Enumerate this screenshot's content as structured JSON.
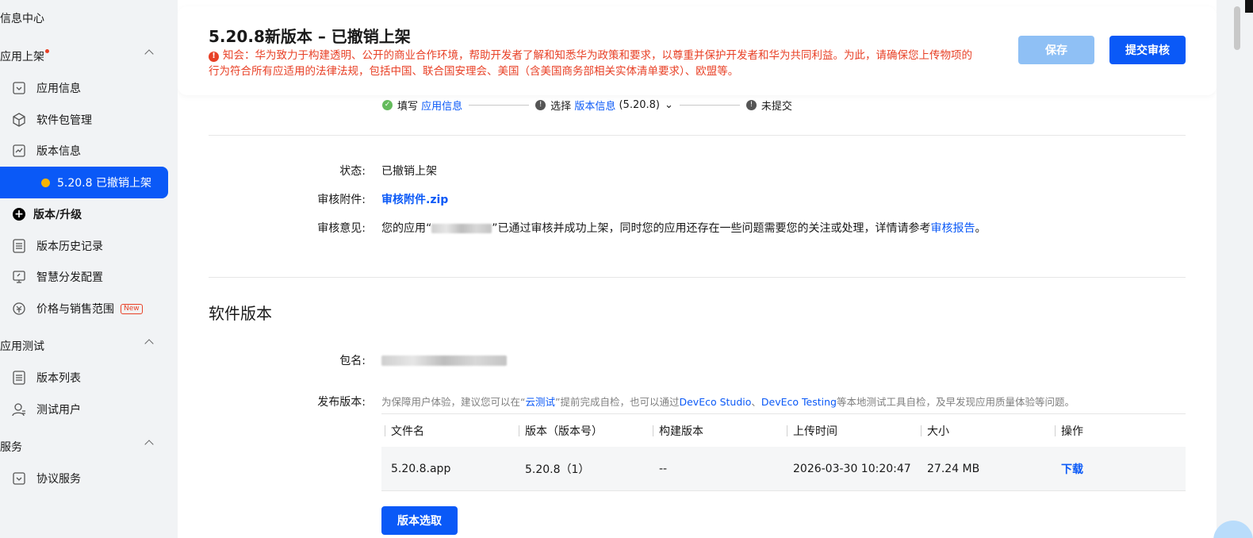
{
  "sidebar": {
    "info_center": "信息中心",
    "groups": {
      "publish": "应用上架",
      "version_info": "版本信息",
      "app_test": "应用测试",
      "services": "服务"
    },
    "items": {
      "app_info": "应用信息",
      "package_mgmt": "软件包管理",
      "active_version": "5.20.8 已撤销上架",
      "version_upgrade": "版本/升级",
      "version_history": "版本历史记录",
      "smart_distribution": "智慧分发配置",
      "price_sales": "价格与销售范围",
      "new_badge": "New",
      "version_list": "版本列表",
      "test_users": "测试用户",
      "agreement_service": "协议服务"
    }
  },
  "header": {
    "title": "5.20.8新版本 – 已撤销上架",
    "notice_line1": "知会：华为致力于构建透明、公开的商业合作环境，帮助开发者了解和知悉华为政策和要求，以尊重并保护开发者和华为共同利益。为此，请确保您上传物项的",
    "notice_line2": "行为符合所有应适用的法律法规，包括中国、联合国安理会、美国（含美国商务部相关实体清单要求）、欧盟等。",
    "save_label": "保存",
    "submit_label": "提交审核"
  },
  "steps": {
    "step1_prefix": "填写",
    "step1_link": "应用信息",
    "step2_prefix": "选择",
    "step2_link": "版本信息",
    "step2_version": "(5.20.8)",
    "step3": "未提交"
  },
  "review": {
    "status_label": "状态:",
    "status_value": "已撤销上架",
    "attachment_label": "审核附件:",
    "attachment_value": "审核附件.zip",
    "opinion_label": "审核意见:",
    "opinion_prefix": "您的应用“",
    "opinion_middle": "”已通过审核并成功上架，同时您的应用还存在一些问题需要您的关注或处理，详情请参考",
    "opinion_link": "审核报告",
    "opinion_suffix": "。"
  },
  "software": {
    "section_title": "软件版本",
    "package_label": "包名:",
    "release_label": "发布版本:",
    "hint_1": "为保障用户体验，建议您可以在“",
    "hint_link1": "云测试",
    "hint_2": "”提前完成自检，也可以通过",
    "hint_link2": "DevEco Studio",
    "hint_3": "、",
    "hint_link3": "DevEco Testing",
    "hint_4": "等本地测试工具自检，及早发现应用质量体验等问题。",
    "columns": [
      "文件名",
      "版本（版本号）",
      "构建版本",
      "上传时间",
      "大小",
      "操作"
    ],
    "row": {
      "file": "5.20.8.app",
      "version": "5.20.8（1）",
      "build": "--",
      "upload_time": "2026-03-30 10:20:47",
      "size": "27.24 MB",
      "action": "下载"
    },
    "pick_button": "版本选取"
  }
}
